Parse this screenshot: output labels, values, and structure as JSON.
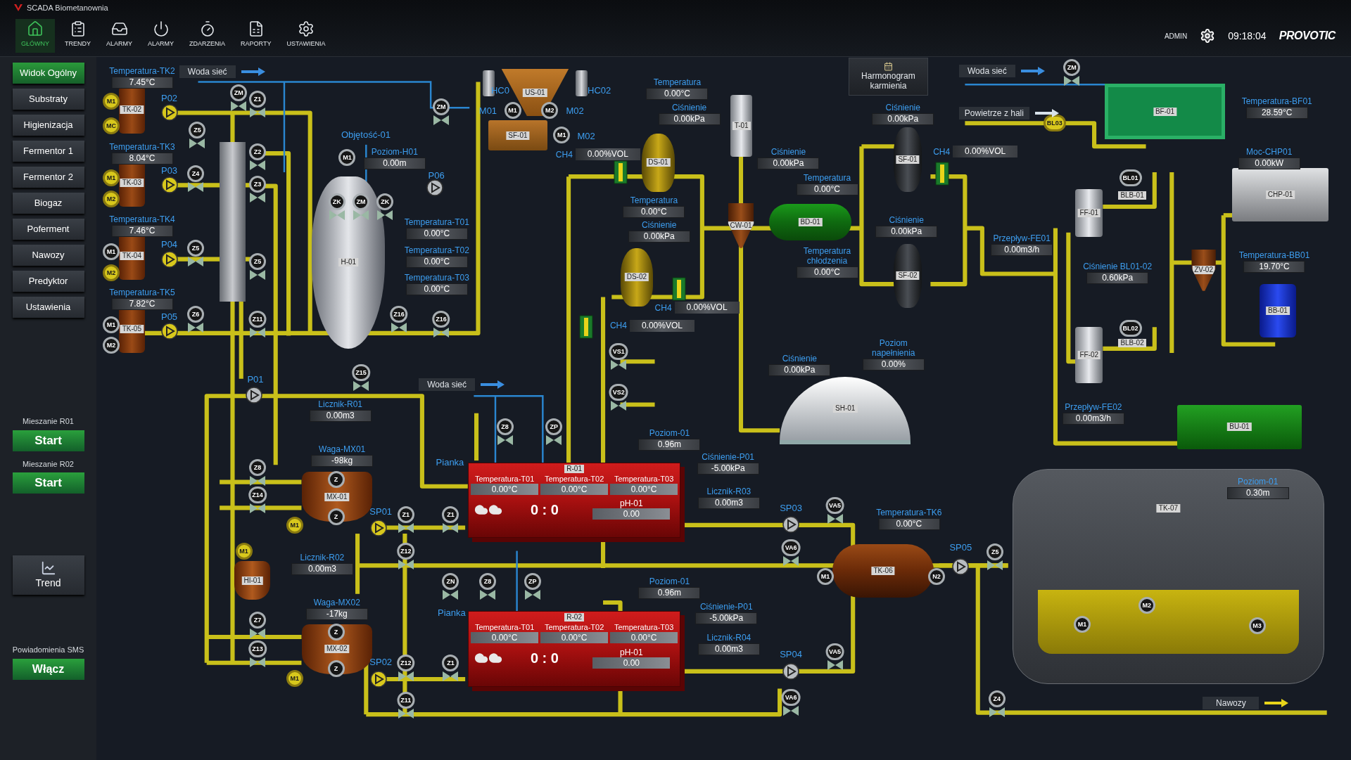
{
  "window": {
    "title": "SCADA Biometanownia"
  },
  "toolbar": {
    "buttons": [
      {
        "label": "GŁÓWNY",
        "selected": true
      },
      {
        "label": "TRENDY",
        "selected": false
      },
      {
        "label": "ALARMY",
        "selected": false
      },
      {
        "label": "ALARMY",
        "selected": false
      },
      {
        "label": "ZDARZENIA",
        "selected": false
      },
      {
        "label": "RAPORTY",
        "selected": false
      },
      {
        "label": "USTAWIENIA",
        "selected": false
      }
    ],
    "user": "ADMIN",
    "time": "09:18:04",
    "logo": "PROVOTIC"
  },
  "sidebar": {
    "items": [
      {
        "label": "Widok Ogólny",
        "selected": true
      },
      {
        "label": "Substraty",
        "selected": false
      },
      {
        "label": "Higienizacja",
        "selected": false
      },
      {
        "label": "Fermentor 1",
        "selected": false
      },
      {
        "label": "Fermentor 2",
        "selected": false
      },
      {
        "label": "Biogaz",
        "selected": false
      },
      {
        "label": "Poferment",
        "selected": false
      },
      {
        "label": "Nawozy",
        "selected": false
      },
      {
        "label": "Predyktor",
        "selected": false
      },
      {
        "label": "Ustawienia",
        "selected": false
      }
    ],
    "mixing": [
      {
        "caption": "Mieszanie R01",
        "button": "Start"
      },
      {
        "caption": "Mieszanie R02",
        "button": "Start"
      }
    ],
    "trend": "Trend",
    "sms": {
      "caption": "Powiadomienia SMS",
      "button": "Włącz"
    }
  },
  "diagram": {
    "schedule_button": "Harmonogram karmienia",
    "flows": [
      {
        "label": "Woda sieć",
        "kind": "water"
      },
      {
        "label": "Woda sieć",
        "kind": "water"
      },
      {
        "label": "Woda sieć",
        "kind": "water"
      },
      {
        "label": "Powietrze z hali",
        "kind": "air"
      },
      {
        "label": "Nawozy",
        "kind": "product"
      }
    ],
    "readouts": [
      {
        "label": "Temperatura-TK2",
        "value": "7.45°C"
      },
      {
        "label": "Temperatura-TK3",
        "value": "8.04°C"
      },
      {
        "label": "Temperatura-TK4",
        "value": "7.46°C"
      },
      {
        "label": "Temperatura-TK5",
        "value": "7.82°C"
      },
      {
        "label": "Poziom-H01",
        "value": "0.00m"
      },
      {
        "label": "Temperatura-T01",
        "value": "0.00°C"
      },
      {
        "label": "Temperatura-T02",
        "value": "0.00°C"
      },
      {
        "label": "Temperatura-T03",
        "value": "0.00°C"
      },
      {
        "label": "Temperatura",
        "value": "0.00°C"
      },
      {
        "label": "Ciśnienie",
        "value": "0.00kPa"
      },
      {
        "label": "Ciśnienie",
        "value": "0.00kPa"
      },
      {
        "label": "Temperatura",
        "value": "0.00°C"
      },
      {
        "label": "Ciśnienie",
        "value": "0.00kPa"
      },
      {
        "label": "Temperatura",
        "value": "0.00°C"
      },
      {
        "label": "Temperatura chłodzenia",
        "value": "0.00°C"
      },
      {
        "label": "Ciśnienie",
        "value": "0.00kPa"
      },
      {
        "label": "Ciśnienie",
        "value": "0.00kPa"
      },
      {
        "label": "Ciśnienie",
        "value": "0.00kPa"
      },
      {
        "label": "Poziom napełnienia",
        "value": "0.00%"
      },
      {
        "label": "Przepływ-FE01",
        "value": "0.00m3/h"
      },
      {
        "label": "Ciśnienie BL01-02",
        "value": "0.60kPa"
      },
      {
        "label": "Przepływ-FE02",
        "value": "0.00m3/h"
      },
      {
        "label": "Temperatura-BF01",
        "value": "28.59°C"
      },
      {
        "label": "Moc-CHP01",
        "value": "0.00kW"
      },
      {
        "label": "Temperatura-BB01",
        "value": "19.70°C"
      },
      {
        "label": "Licznik-R01",
        "value": "0.00m3"
      },
      {
        "label": "Waga-MX01",
        "value": "-98kg"
      },
      {
        "label": "Licznik-R02",
        "value": "0.00m3"
      },
      {
        "label": "Waga-MX02",
        "value": "-17kg"
      },
      {
        "label": "Poziom-01",
        "value": "0.96m"
      },
      {
        "label": "Ciśnienie-P01",
        "value": "-5.00kPa"
      },
      {
        "label": "Licznik-R03",
        "value": "0.00m3"
      },
      {
        "label": "Poziom-01",
        "value": "0.96m"
      },
      {
        "label": "Ciśnienie-P01",
        "value": "-5.00kPa"
      },
      {
        "label": "Licznik-R04",
        "value": "0.00m3"
      },
      {
        "label": "Temperatura-TK6",
        "value": "0.00°C"
      },
      {
        "label": "Poziom-01",
        "value": "0.30m"
      }
    ],
    "gas_sensors": [
      {
        "label": "CH4",
        "value": "0.00%VOL"
      },
      {
        "label": "CH4",
        "value": "0.00%VOL"
      },
      {
        "label": "CH4",
        "value": "0.00%VOL"
      },
      {
        "label": "CH4",
        "value": "0.00%VOL"
      }
    ],
    "labels": [
      "P02",
      "P03",
      "P04",
      "P05",
      "HC0",
      "HC02",
      "M01",
      "M02",
      "M02",
      "P06",
      "Objętość-01",
      "P01",
      "Pianka",
      "SP01",
      "Pianka",
      "SP02",
      "SP03",
      "SP04",
      "SP05"
    ],
    "equipment": [
      {
        "tag": "TK-02",
        "kind": "tank"
      },
      {
        "tag": "TK-03",
        "kind": "tank"
      },
      {
        "tag": "TK-04",
        "kind": "tank"
      },
      {
        "tag": "TK-05",
        "kind": "tank"
      },
      {
        "tag": "H-01",
        "kind": "vessel"
      },
      {
        "tag": "US-01",
        "kind": "hopper"
      },
      {
        "tag": "SF-01",
        "kind": "box"
      },
      {
        "tag": "DS-01",
        "kind": "digester"
      },
      {
        "tag": "DS-02",
        "kind": "digester"
      },
      {
        "tag": "T-01",
        "kind": "cylinder"
      },
      {
        "tag": "CW-01",
        "kind": "cone"
      },
      {
        "tag": "BD-01",
        "kind": "cooler"
      },
      {
        "tag": "SF-01",
        "kind": "filter"
      },
      {
        "tag": "SF-02",
        "kind": "filter"
      },
      {
        "tag": "BF-01",
        "kind": "biofilter"
      },
      {
        "tag": "CHP-01",
        "kind": "engine"
      },
      {
        "tag": "FF-01",
        "kind": "cylinder"
      },
      {
        "tag": "FF-02",
        "kind": "cylinder"
      },
      {
        "tag": "BLB-01",
        "kind": "label"
      },
      {
        "tag": "BLB-02",
        "kind": "label"
      },
      {
        "tag": "ZV-02",
        "kind": "cone"
      },
      {
        "tag": "BB-01",
        "kind": "boiler"
      },
      {
        "tag": "BU-01",
        "kind": "unit"
      },
      {
        "tag": "SH-01",
        "kind": "dome"
      },
      {
        "tag": "MX-01",
        "kind": "mixer"
      },
      {
        "tag": "MX-02",
        "kind": "mixer"
      },
      {
        "tag": "HI-01",
        "kind": "mixer"
      },
      {
        "tag": "TK-06",
        "kind": "tanker"
      },
      {
        "tag": "TK-07",
        "kind": "storage"
      }
    ],
    "reactors": [
      {
        "tag": "R-01",
        "temps": [
          {
            "label": "Temperatura-T01",
            "value": "0.00°C"
          },
          {
            "label": "Temperatura-T02",
            "value": "0.00°C"
          },
          {
            "label": "Temperatura-T03",
            "value": "0.00°C"
          }
        ],
        "ph": {
          "label": "pH-01",
          "value": "0.00"
        },
        "counter": "0 : 0"
      },
      {
        "tag": "R-02",
        "temps": [
          {
            "label": "Temperatura-T01",
            "value": "0.00°C"
          },
          {
            "label": "Temperatura-T02",
            "value": "0.00°C"
          },
          {
            "label": "Temperatura-T03",
            "value": "0.00°C"
          }
        ],
        "ph": {
          "label": "pH-01",
          "value": "0.00"
        },
        "counter": "0 : 0"
      }
    ],
    "symbols": [
      {
        "text": "M1",
        "kind": "motor",
        "active": true
      },
      {
        "text": "MC",
        "kind": "motor",
        "active": true
      },
      {
        "text": "M1",
        "kind": "motor",
        "active": true
      },
      {
        "text": "M2",
        "kind": "motor",
        "active": true
      },
      {
        "text": "M1",
        "kind": "motor",
        "active": false
      },
      {
        "text": "M2",
        "kind": "motor",
        "active": true
      },
      {
        "text": "M1",
        "kind": "motor",
        "active": false
      },
      {
        "text": "M2",
        "kind": "motor",
        "active": false
      },
      {
        "text": "ZM",
        "kind": "valve",
        "active": false
      },
      {
        "text": "Z1",
        "kind": "valve",
        "active": false
      },
      {
        "text": "Z5",
        "kind": "valve",
        "active": false
      },
      {
        "text": "Z2",
        "kind": "valve",
        "active": false
      },
      {
        "text": "Z4",
        "kind": "valve",
        "active": false
      },
      {
        "text": "Z3",
        "kind": "valve",
        "active": false
      },
      {
        "text": "Z5",
        "kind": "valve",
        "active": false
      },
      {
        "text": "Z5",
        "kind": "valve",
        "active": false
      },
      {
        "text": "Z6",
        "kind": "valve",
        "active": false
      },
      {
        "text": "Z11",
        "kind": "valve",
        "active": false
      },
      {
        "text": "ZM",
        "kind": "valve",
        "active": false
      },
      {
        "text": "M1",
        "kind": "motor",
        "active": false
      },
      {
        "text": "ZK",
        "kind": "valve",
        "active": false
      },
      {
        "text": "ZM",
        "kind": "valve",
        "active": false
      },
      {
        "text": "ZK",
        "kind": "valve",
        "active": false
      },
      {
        "text": "Z16",
        "kind": "valve",
        "active": false
      },
      {
        "text": "Z16",
        "kind": "valve",
        "active": false
      },
      {
        "text": "Z15",
        "kind": "valve",
        "active": false
      },
      {
        "text": "M1",
        "kind": "motor",
        "active": false
      },
      {
        "text": "M2",
        "kind": "motor",
        "active": false
      },
      {
        "text": "M1",
        "kind": "motor",
        "active": false
      },
      {
        "text": "VS1",
        "kind": "valve",
        "active": false
      },
      {
        "text": "VS2",
        "kind": "valve",
        "active": false
      },
      {
        "text": "Z8",
        "kind": "valve",
        "active": false
      },
      {
        "text": "ZP",
        "kind": "valve",
        "active": false
      },
      {
        "text": "Z8",
        "kind": "valve",
        "active": false
      },
      {
        "text": "Z14",
        "kind": "valve",
        "active": false
      },
      {
        "text": "M1",
        "kind": "motor",
        "active": true
      },
      {
        "text": "Z",
        "kind": "motor",
        "active": false
      },
      {
        "text": "Z",
        "kind": "motor",
        "active": false
      },
      {
        "text": "Z1",
        "kind": "valve",
        "active": false
      },
      {
        "text": "Z1",
        "kind": "valve",
        "active": false
      },
      {
        "text": "Z12",
        "kind": "valve",
        "active": false
      },
      {
        "text": "ZN",
        "kind": "valve",
        "active": false
      },
      {
        "text": "Z8",
        "kind": "valve",
        "active": false
      },
      {
        "text": "ZP",
        "kind": "valve",
        "active": false
      },
      {
        "text": "M1",
        "kind": "motor",
        "active": true
      },
      {
        "text": "Z7",
        "kind": "valve",
        "active": false
      },
      {
        "text": "Z13",
        "kind": "valve",
        "active": false
      },
      {
        "text": "M1",
        "kind": "motor",
        "active": true
      },
      {
        "text": "Z",
        "kind": "motor",
        "active": false
      },
      {
        "text": "Z",
        "kind": "motor",
        "active": false
      },
      {
        "text": "Z12",
        "kind": "valve",
        "active": false
      },
      {
        "text": "Z1",
        "kind": "valve",
        "active": false
      },
      {
        "text": "Z11",
        "kind": "valve",
        "active": false
      },
      {
        "text": "VA5",
        "kind": "valve",
        "active": false
      },
      {
        "text": "VA6",
        "kind": "valve",
        "active": false
      },
      {
        "text": "VA5",
        "kind": "valve",
        "active": false
      },
      {
        "text": "VA6",
        "kind": "valve",
        "active": false
      },
      {
        "text": "M1",
        "kind": "motor",
        "active": false
      },
      {
        "text": "N2",
        "kind": "motor",
        "active": false
      },
      {
        "text": "Z5",
        "kind": "valve",
        "active": false
      },
      {
        "text": "Z4",
        "kind": "valve",
        "active": false
      },
      {
        "text": "ZM",
        "kind": "valve",
        "active": false
      },
      {
        "text": "BL03",
        "kind": "motor",
        "active": true
      },
      {
        "text": "BL01",
        "kind": "motor",
        "active": false
      },
      {
        "text": "BL02",
        "kind": "motor",
        "active": false
      },
      {
        "text": "M1",
        "kind": "motor",
        "active": false
      },
      {
        "text": "M2",
        "kind": "motor",
        "active": false
      },
      {
        "text": "M3",
        "kind": "motor",
        "active": false
      }
    ],
    "pumps": [
      {
        "active": true
      },
      {
        "active": true
      },
      {
        "active": true
      },
      {
        "active": true
      },
      {
        "active": false
      },
      {
        "active": false
      },
      {
        "active": true
      },
      {
        "active": true
      },
      {
        "active": false
      },
      {
        "active": false
      },
      {
        "active": false
      }
    ]
  }
}
